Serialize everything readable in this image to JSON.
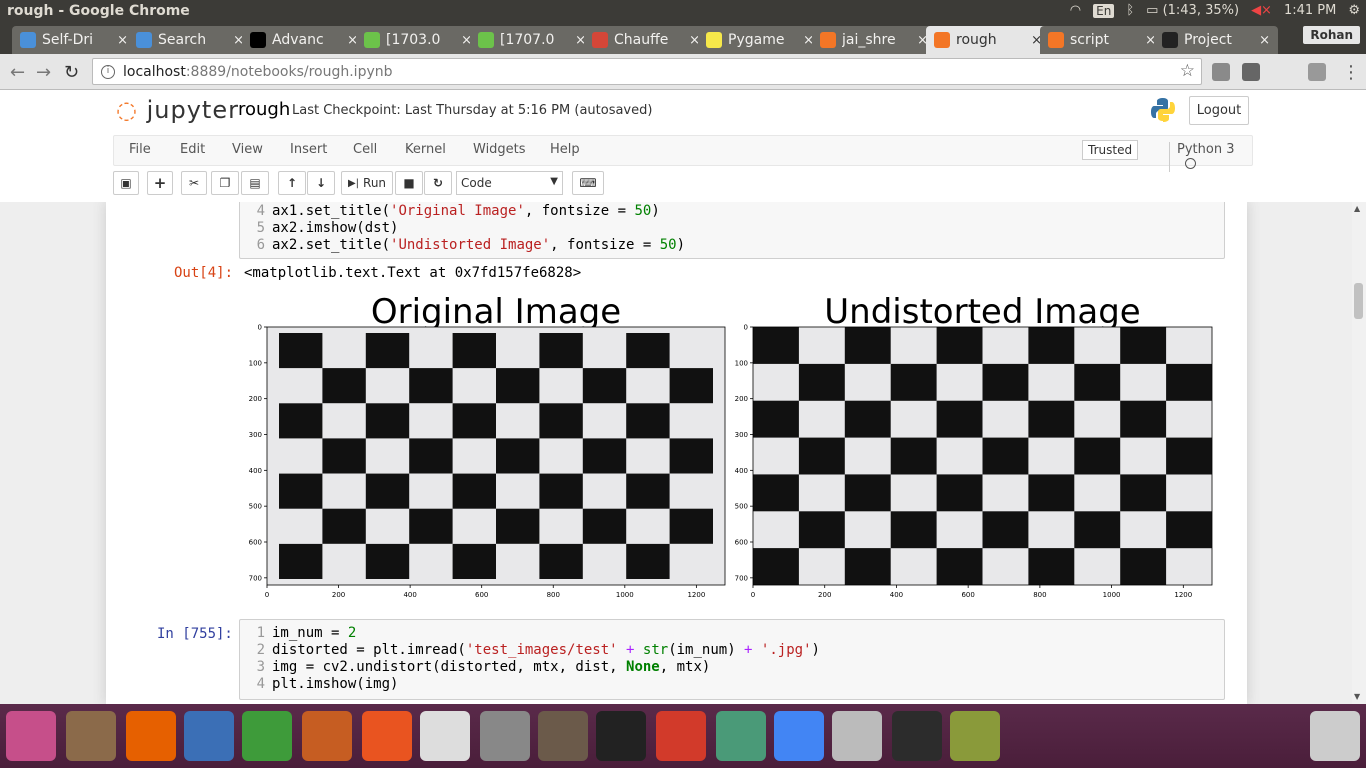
{
  "window": {
    "title": "rough - Google Chrome"
  },
  "tray": {
    "lang": "En",
    "battery": "(1:43, 35%)",
    "time": "1:41 PM"
  },
  "profile": "Rohan",
  "tabs": [
    {
      "label": "Self-Dri",
      "icon": "blue-logo-icon",
      "color": "#4a90d9"
    },
    {
      "label": "Search",
      "icon": "blue-logo-icon",
      "color": "#4a90d9"
    },
    {
      "label": "Advanc",
      "icon": "medium-icon",
      "color": "#000000"
    },
    {
      "label": "[1703.0",
      "icon": "smiley-icon",
      "color": "#6cc24a"
    },
    {
      "label": "[1707.0",
      "icon": "smiley-icon",
      "color": "#6cc24a"
    },
    {
      "label": "Chauffe",
      "icon": "gmail-icon",
      "color": "#d44638"
    },
    {
      "label": "Pygame",
      "icon": "pygame-icon",
      "color": "#f6e84a"
    },
    {
      "label": "jai_shre",
      "icon": "jupyter-file-icon",
      "color": "#f37626"
    },
    {
      "label": "rough",
      "icon": "jupyter-file-icon",
      "color": "#f37626"
    },
    {
      "label": "script",
      "icon": "hourglass-icon",
      "color": "#f37626"
    },
    {
      "label": "Project",
      "icon": "github-icon",
      "color": "#222222"
    }
  ],
  "address": {
    "host": "localhost",
    "rest": ":8889/notebooks/rough.ipynb"
  },
  "jupyter": {
    "logo": "jupyter",
    "notebook_name": "rough",
    "checkpoint": "Last Checkpoint: Last Thursday at 5:16 PM  (autosaved)",
    "logout": "Logout",
    "menus": [
      "File",
      "Edit",
      "View",
      "Insert",
      "Cell",
      "Kernel",
      "Widgets",
      "Help"
    ],
    "trusted": "Trusted",
    "kernel": "Python 3",
    "run": "Run",
    "cell_type": "Code"
  },
  "cell1": {
    "lines": [
      {
        "n": "4",
        "text": "ax1.set_title("
      },
      {
        "n": "5",
        "text": "ax2.imshow(dst)"
      },
      {
        "n": "6",
        "text": "ax2.set_title("
      }
    ],
    "s1": "'Original Image'",
    "s2": "'Undistorted Image'",
    "fs": ", fontsize = ",
    "num": "50",
    "close": ")"
  },
  "out4": {
    "prompt": "Out[4]:",
    "text": "<matplotlib.text.Text at 0x7fd157fe6828>"
  },
  "cell2": {
    "prompt": "In [755]:",
    "l1a": "im_num = ",
    "l1b": "2",
    "l2a": "distorted = plt.imread(",
    "l2b": "'test_images/test'",
    "l2c": " + ",
    "l2d": "str",
    "l2e": "(im_num) ",
    "l2f": "+",
    "l2g": " ",
    "l2h": "'.jpg'",
    "l2i": ")",
    "l3a": "img = cv2.undistort(distorted, mtx, dist, ",
    "l3b": "None",
    "l3c": ", mtx)",
    "l4a": "plt.imshow(img)"
  },
  "chart_data": [
    {
      "type": "image",
      "title": "Original Image",
      "xticks": [
        0,
        200,
        400,
        600,
        800,
        1000,
        1200
      ],
      "yticks": [
        0,
        100,
        200,
        300,
        400,
        500,
        600,
        700
      ],
      "xlim": [
        0,
        1280
      ],
      "ylim": [
        720,
        0
      ],
      "content": "checkerboard, 10x7 squares, barrel distortion"
    },
    {
      "type": "image",
      "title": "Undistorted Image",
      "xticks": [
        0,
        200,
        400,
        600,
        800,
        1000,
        1200
      ],
      "yticks": [
        0,
        100,
        200,
        300,
        400,
        500,
        600,
        700
      ],
      "xlim": [
        0,
        1280
      ],
      "ylim": [
        720,
        0
      ],
      "content": "checkerboard, 10x7 squares, straight lines"
    }
  ],
  "dock": [
    {
      "name": "ubuntu-dash-icon",
      "color": "#c64f8a"
    },
    {
      "name": "files-icon",
      "color": "#8b6a4a"
    },
    {
      "name": "firefox-icon",
      "color": "#e66000"
    },
    {
      "name": "writer-icon",
      "color": "#3b6fb6"
    },
    {
      "name": "calc-icon",
      "color": "#3e9b3a"
    },
    {
      "name": "impress-icon",
      "color": "#c65d22"
    },
    {
      "name": "software-center-icon",
      "color": "#e95420"
    },
    {
      "name": "amazon-icon",
      "color": "#dddddd"
    },
    {
      "name": "settings-icon",
      "color": "#888888"
    },
    {
      "name": "gimp-icon",
      "color": "#6b5a4a"
    },
    {
      "name": "inkscape-icon",
      "color": "#222222"
    },
    {
      "name": "tiles-icon",
      "color": "#d23a2a"
    },
    {
      "name": "atom-icon",
      "color": "#4a9a78"
    },
    {
      "name": "chrome-icon",
      "color": "#4285f4"
    },
    {
      "name": "disk-icon",
      "color": "#bbbbbb"
    },
    {
      "name": "terminal-icon",
      "color": "#2c2c2c"
    },
    {
      "name": "magnifier-icon",
      "color": "#8a9a3a"
    },
    {
      "name": "trash-icon",
      "color": "#cccccc"
    }
  ]
}
